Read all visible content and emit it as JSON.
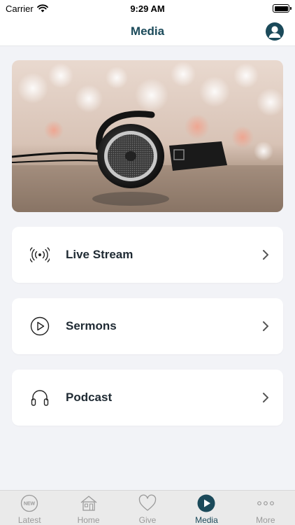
{
  "status_bar": {
    "carrier": "Carrier",
    "time": "9:29 AM"
  },
  "nav": {
    "title": "Media"
  },
  "hero": {
    "image_subject": "headphones-photo"
  },
  "menu": [
    {
      "label": "Live Stream",
      "icon": "broadcast-icon"
    },
    {
      "label": "Sermons",
      "icon": "play-circle-icon"
    },
    {
      "label": "Podcast",
      "icon": "headphones-icon"
    }
  ],
  "tabs": [
    {
      "label": "Latest",
      "icon": "new-badge-icon",
      "badge_text": "NEW",
      "active": false
    },
    {
      "label": "Home",
      "icon": "house-icon",
      "active": false
    },
    {
      "label": "Give",
      "icon": "heart-icon",
      "active": false
    },
    {
      "label": "Media",
      "icon": "play-icon",
      "active": true
    },
    {
      "label": "More",
      "icon": "ellipsis-icon",
      "active": false
    }
  ],
  "colors": {
    "accent": "#1b4a5a",
    "background": "#f2f3f7",
    "tab_inactive": "#9a9a9a"
  }
}
